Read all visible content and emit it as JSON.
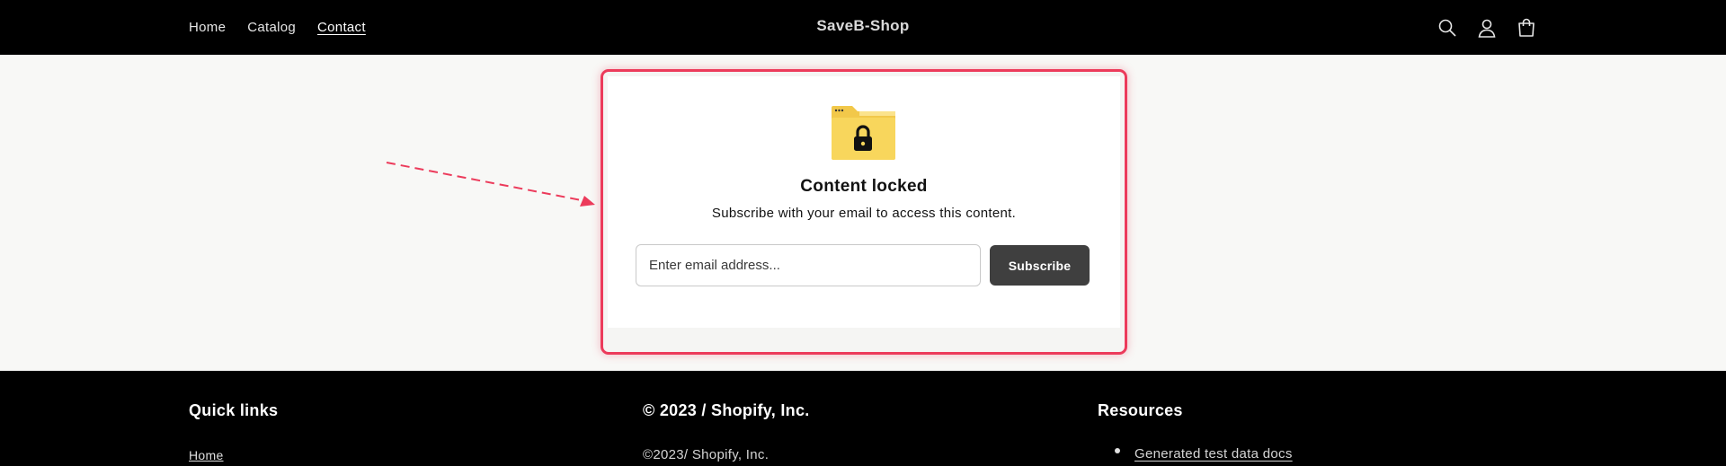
{
  "header": {
    "nav": [
      {
        "label": "Home"
      },
      {
        "label": "Catalog"
      },
      {
        "label": "Contact",
        "active": true
      }
    ],
    "brand": "SaveB-Shop",
    "icons": [
      "search-icon",
      "account-icon",
      "cart-icon"
    ]
  },
  "lock_card": {
    "icon": "locked-folder-icon",
    "title": "Content locked",
    "subtitle": "Subscribe with your email to access this content.",
    "email_placeholder": "Enter email address...",
    "subscribe_label": "Subscribe",
    "highlight_color": "#ec3b5b",
    "button_color": "#3f3f3f"
  },
  "footer": {
    "col1": {
      "heading": "Quick links",
      "items": [
        "Home"
      ]
    },
    "col2": {
      "heading": "© 2023 / Shopify, Inc.",
      "text": "©2023/ Shopify, Inc."
    },
    "col3": {
      "heading": "Resources",
      "links": [
        "Generated test data docs"
      ]
    }
  }
}
